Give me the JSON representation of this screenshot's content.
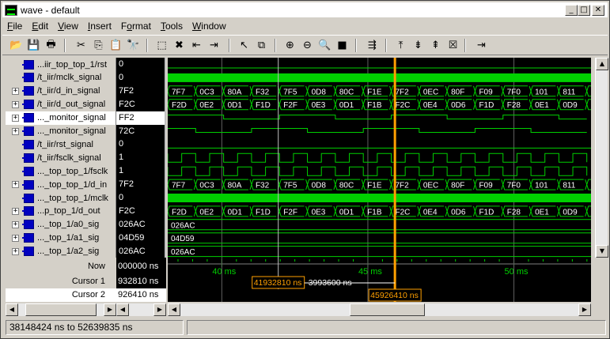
{
  "window": {
    "title": "wave - default",
    "min_glyph": "_",
    "max_glyph": "□",
    "close_glyph": "✕"
  },
  "menu": [
    "File",
    "Edit",
    "View",
    "Insert",
    "Format",
    "Tools",
    "Window"
  ],
  "menu_hotkeys": [
    "F",
    "E",
    "V",
    "I",
    "o",
    "T",
    "W"
  ],
  "toolbar": [
    "open-icon",
    "save-icon",
    "print-icon",
    "cut-icon",
    "copy-icon",
    "paste-icon",
    "find-icon",
    "select-icon",
    "delete-icon",
    "insert-left-icon",
    "insert-right-icon",
    "pointer-icon",
    "zoom-mode-icon",
    "zoom-in-icon",
    "zoom-out-icon",
    "zoom-full-icon",
    "stop-icon",
    "goto-icon",
    "add-cursor-1-icon",
    "add-cursor-2-icon",
    "add-cursor-3-icon",
    "delete-cursor-icon",
    "find-edge-icon"
  ],
  "toolbar_glyphs": [
    "📂",
    "💾",
    "🖶",
    "✂",
    "⎘",
    "📋",
    "🔭",
    "⬚",
    "✖",
    "⇤",
    "⇥",
    "↖",
    "⧉",
    "⊕",
    "⊖",
    "🔍",
    "■",
    "⇶",
    "⤒",
    "⇟",
    "⇞",
    "☒",
    "⇥"
  ],
  "signals": [
    {
      "name": "...iir_top_top_1/rst",
      "value": "0",
      "expandable": false
    },
    {
      "name": "/t_iir/mclk_signal",
      "value": "0",
      "expandable": false
    },
    {
      "name": "/t_iir/d_in_signal",
      "value": "7F2",
      "expandable": true
    },
    {
      "name": "/t_iir/d_out_signal",
      "value": "F2C",
      "expandable": true
    },
    {
      "name": "..._monitor_signal",
      "value": "FF2",
      "expandable": true,
      "selected": true
    },
    {
      "name": "..._monitor_signal",
      "value": "72C",
      "expandable": true
    },
    {
      "name": "/t_iir/rst_signal",
      "value": "0",
      "expandable": false
    },
    {
      "name": "/t_iir/fsclk_signal",
      "value": "1",
      "expandable": false
    },
    {
      "name": "..._top_top_1/fsclk",
      "value": "1",
      "expandable": false
    },
    {
      "name": "..._top_top_1/d_in",
      "value": "7F2",
      "expandable": true
    },
    {
      "name": "..._top_top_1/mclk",
      "value": "0",
      "expandable": false
    },
    {
      "name": "...p_top_1/d_out",
      "value": "F2C",
      "expandable": true
    },
    {
      "name": "..._top_1/a0_sig",
      "value": "026AC",
      "expandable": true
    },
    {
      "name": "..._top_1/a1_sig",
      "value": "04D59",
      "expandable": true
    },
    {
      "name": "..._top_1/a2_sig",
      "value": "026AC",
      "expandable": true
    }
  ],
  "bus_din": [
    "7F7",
    "0C3",
    "80A",
    "F32",
    "7F5",
    "0D8",
    "80C",
    "F1E",
    "7F2",
    "0EC",
    "80F",
    "F09",
    "7F0",
    "101",
    "811"
  ],
  "bus_dout": [
    "F2D",
    "0E2",
    "0D1",
    "F1D",
    "F2F",
    "0E3",
    "0D1",
    "F1B",
    "F2C",
    "0E4",
    "0D6",
    "F1D",
    "F28",
    "0E1",
    "0D9"
  ],
  "bus_a0": "026AC",
  "bus_a1": "04D59",
  "bus_a2": "026AC",
  "cursors": {
    "now_label": "Now",
    "now_value": "000000 ns",
    "c1_label": "Cursor 1",
    "c1_value": "932810 ns",
    "c2_label": "Cursor 2",
    "c2_value": "926410 ns",
    "c1_box": "41932810 ns",
    "c2_box": "45926410 ns",
    "delta": "3993600 ns"
  },
  "timeline": [
    "40 ms",
    "45 ms",
    "50 ms"
  ],
  "status": {
    "range": "38148424 ns to 52639835 ns"
  },
  "colors": {
    "wave": "#00d000",
    "cursor": "#ffa000",
    "bg": "#000000",
    "grid": "#808080"
  }
}
